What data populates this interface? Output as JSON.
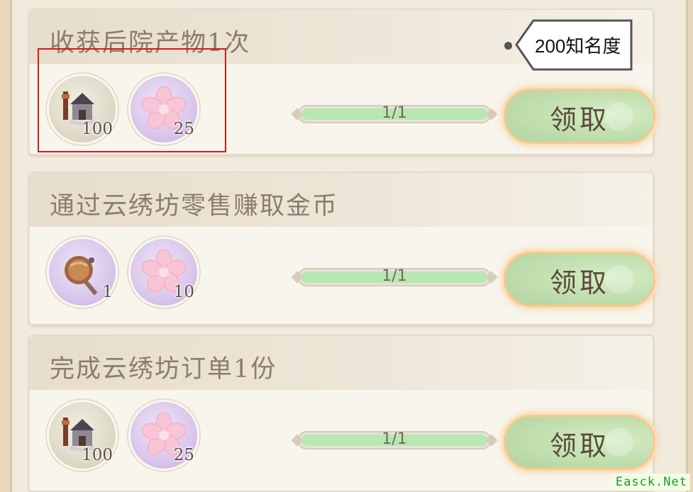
{
  "tasks": [
    {
      "title": "收获后院产物1次",
      "rewards": [
        {
          "icon": "house-icon",
          "count": "100"
        },
        {
          "icon": "sakura-icon",
          "count": "25"
        }
      ],
      "progress_text": "1/1",
      "progress_fraction": 1.0,
      "claim_label": "领取"
    },
    {
      "title": "通过云绣坊零售赚取金币",
      "rewards": [
        {
          "icon": "hand-mirror-icon",
          "count": "1"
        },
        {
          "icon": "sakura-icon",
          "count": "10"
        }
      ],
      "progress_text": "1/1",
      "progress_fraction": 1.0,
      "claim_label": "领取"
    },
    {
      "title": "完成云绣坊订单1份",
      "rewards": [
        {
          "icon": "house-icon",
          "count": "100"
        },
        {
          "icon": "sakura-icon",
          "count": "25"
        }
      ],
      "progress_text": "1/1",
      "progress_fraction": 1.0,
      "claim_label": "领取"
    }
  ],
  "tooltip": {
    "text": "200知名度"
  },
  "watermark": "Easck.Net",
  "colors": {
    "highlight": "#d21b1b",
    "progress_fill": "#b9e7b1",
    "claim_button": "#c2dfb0",
    "claim_glow": "#f7c98f"
  }
}
